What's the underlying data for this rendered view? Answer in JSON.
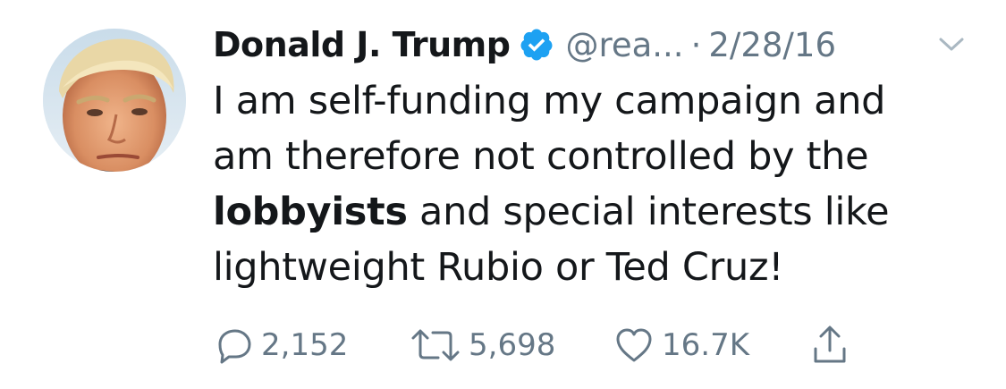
{
  "tweet": {
    "author": {
      "display_name": "Donald J. Trump",
      "handle": "@rea...",
      "verified": true,
      "avatar_icon": "profile-photo"
    },
    "separator": "·",
    "date": "2/28/16",
    "menu_icon": "chevron-down-icon",
    "text": {
      "line1": "I am self-funding my campaign and",
      "line2": "am therefore not controlled by the",
      "line3_bold": "lobbyists",
      "line3_rest": " and special interests like",
      "line4": "lightweight Rubio or Ted Cruz!"
    },
    "actions": {
      "replies": "2,152",
      "retweets": "5,698",
      "likes": "16.7K"
    }
  },
  "colors": {
    "text_primary": "#14171a",
    "text_secondary": "#657786",
    "verified_blue": "#1da1f2",
    "background": "#ffffff"
  }
}
